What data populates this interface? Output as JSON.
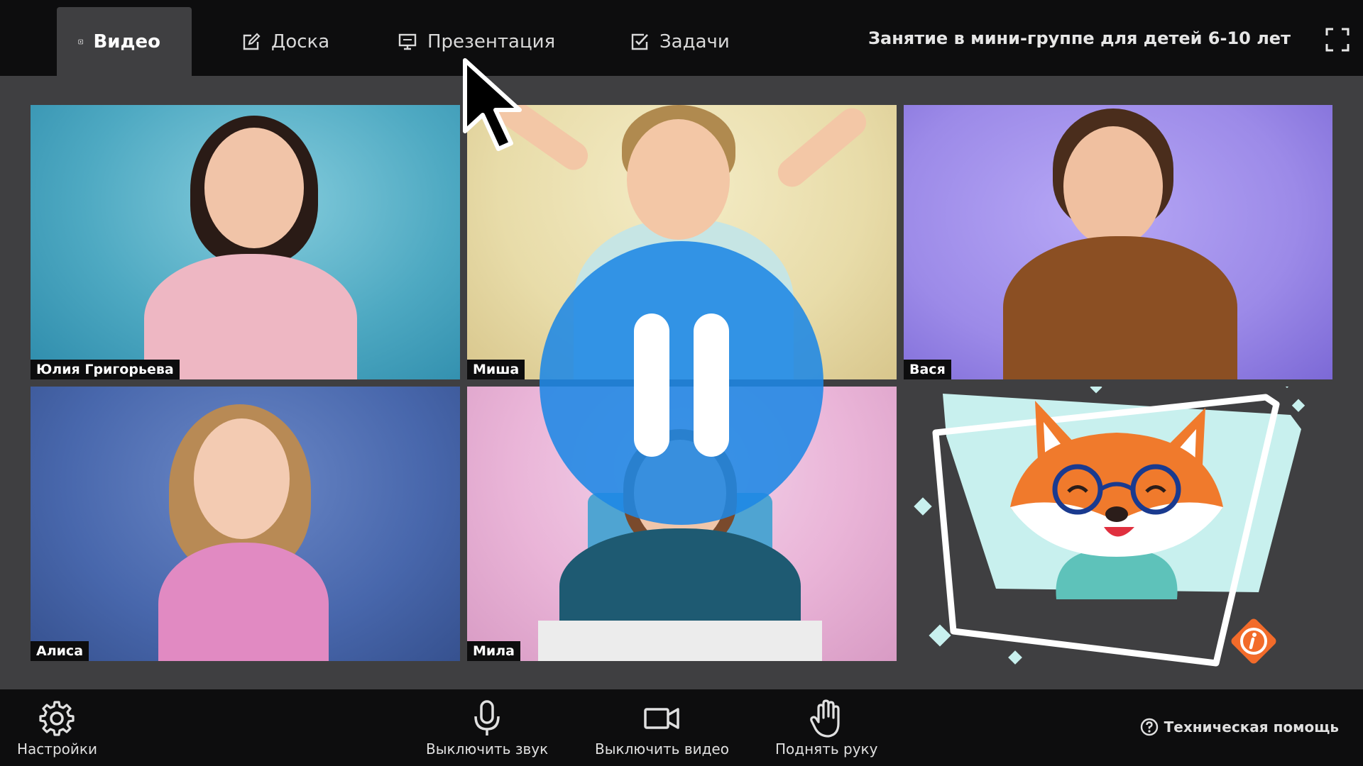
{
  "tabs": [
    {
      "label": "Видео",
      "icon": "play-square-icon",
      "active": true
    },
    {
      "label": "Доска",
      "icon": "edit-icon",
      "active": false
    },
    {
      "label": "Презентация",
      "icon": "presentation-icon",
      "active": false
    },
    {
      "label": "Задачи",
      "icon": "checkbox-icon",
      "active": false
    }
  ],
  "lesson_title": "Занятие в мини-группе для детей 6-10 лет",
  "participants": [
    {
      "name": "Юлия Григорьева"
    },
    {
      "name": "Миша"
    },
    {
      "name": "Вася"
    },
    {
      "name": "Алиса"
    },
    {
      "name": "Мила"
    }
  ],
  "controls": {
    "settings": "Настройки",
    "mute": "Выключить звук",
    "video_off": "Выключить видео",
    "raise_hand": "Поднять руку",
    "help": "Техническая помощь"
  },
  "colors": {
    "bar_background": "#0d0d0e",
    "stage_background": "#3f3f41",
    "pause_blue": "#1e88e5",
    "fox_orange": "#f07a2c",
    "info_orange": "#f26b2a",
    "card_mint": "#c8f0ee"
  },
  "playback_state": "paused"
}
